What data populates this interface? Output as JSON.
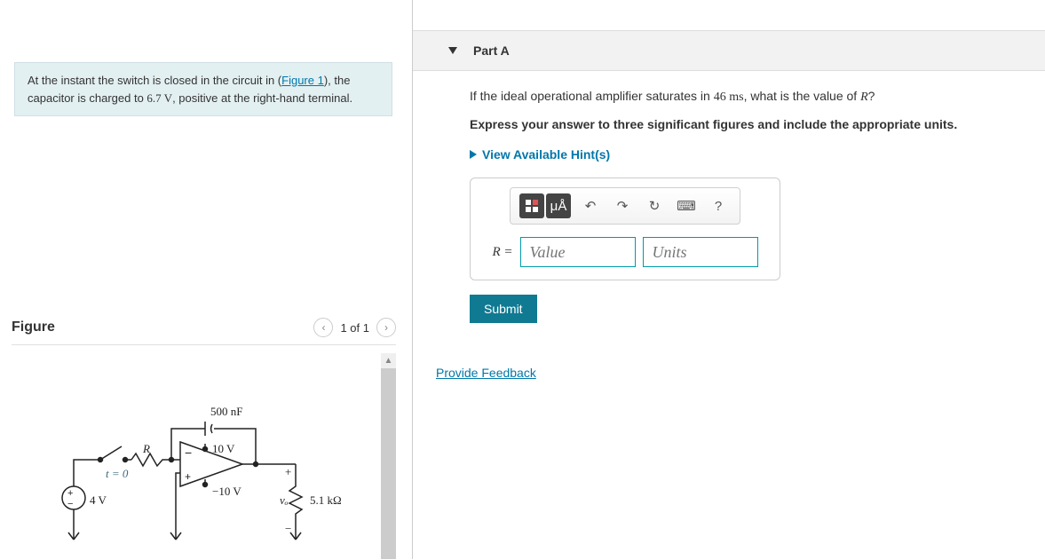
{
  "problem": {
    "text_before_link": "At the instant the switch is closed in the circuit in (",
    "link_text": "Figure 1",
    "text_after_link": "), the capacitor is charged to ",
    "voltage": "6.7 V",
    "text_tail": ", positive at the right-hand terminal."
  },
  "figure": {
    "title": "Figure",
    "counter": "1 of 1"
  },
  "circuit": {
    "cap_label": "500 nF",
    "r_label": "R",
    "t_label": "t = 0",
    "vpos": "10 V",
    "vneg": "−10 V",
    "src_label": "4 V",
    "vo_label": "vₒ",
    "load_label": "5.1 kΩ",
    "plus": "+",
    "minus": "−"
  },
  "part": {
    "title": "Part A",
    "question_pre": "If the ideal operational amplifier saturates in ",
    "time_val": "46 ms",
    "question_post": ", what is the value of ",
    "var": "R",
    "qmark": "?",
    "instructions": "Express your answer to three significant figures and include the appropriate units.",
    "hints_label": "View Available Hint(s)",
    "answer_var": "R =",
    "value_placeholder": "Value",
    "units_placeholder": "Units",
    "submit_label": "Submit"
  },
  "toolbar": {
    "templates_icon": "□",
    "units_icon": "μÅ",
    "undo_icon": "↶",
    "redo_icon": "↷",
    "reset_icon": "↻",
    "keyboard_icon": "⌨",
    "help_icon": "?"
  },
  "feedback": "Provide Feedback"
}
